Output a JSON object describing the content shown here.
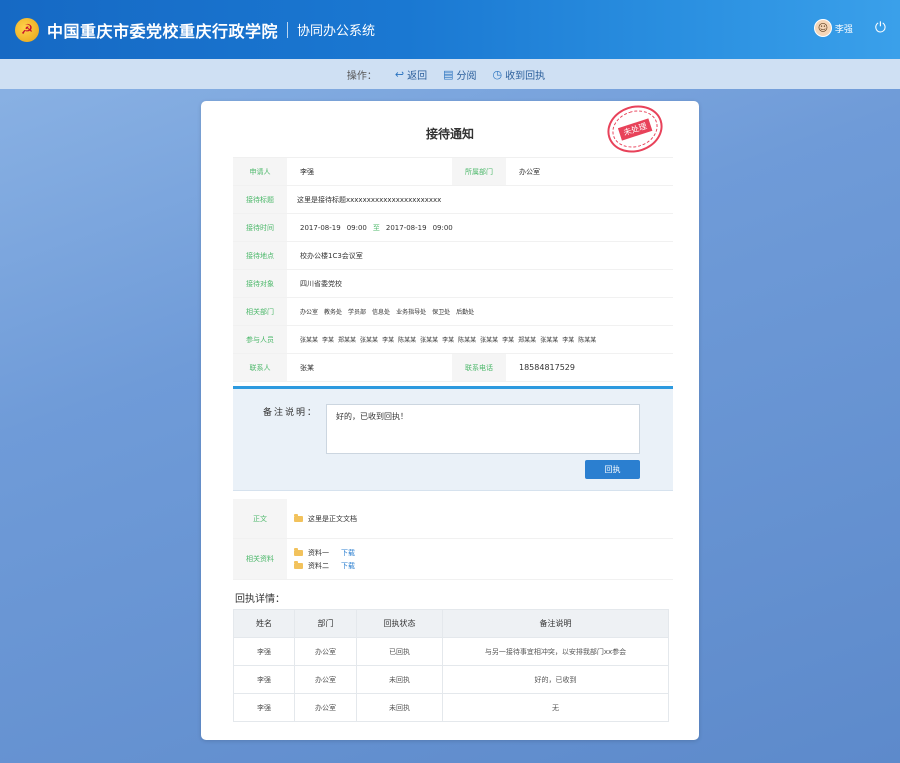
{
  "header": {
    "title": "中国重庆市委党校重庆行政学院",
    "subtitle": "协同办公系统",
    "username": "李强"
  },
  "toolbar": {
    "label": "操作：",
    "buttons": [
      "返回",
      "分阅",
      "收到回执"
    ]
  },
  "card": {
    "title": "接待通知",
    "stamp": "未处理",
    "fields": {
      "applicant_label": "申请人",
      "applicant": "李强",
      "dept_label": "所属部门",
      "dept": "办公室",
      "subject_label": "接待标题",
      "subject": "这里是接待标题xxxxxxxxxxxxxxxxxxxxxxx",
      "time_label": "接待时间",
      "time_start_date": "2017-08-19",
      "time_start": "09:00",
      "time_to": "至",
      "time_end_date": "2017-08-19",
      "time_end": "09:00",
      "place_label": "接待地点",
      "place": "校办公楼1C3会议室",
      "target_label": "接待对象",
      "target": "四川省委党校",
      "depts_label": "相关部门",
      "depts": [
        "办公室",
        "教务处",
        "学员部",
        "信息处",
        "业务指导处",
        "保卫处",
        "后勤处"
      ],
      "people_label": "参与人员",
      "people": [
        "张某某",
        "李某",
        "郑某某",
        "张某某",
        "李某",
        "陈某某",
        "张某某",
        "李某",
        "陈某某",
        "张某某",
        "李某",
        "郑某某",
        "张某某",
        "李某",
        "陈某某"
      ],
      "contact_label": "联系人",
      "contact": "张某",
      "phone_label": "联系电话",
      "phone": "18584817529"
    },
    "reply": {
      "label": "备注说明：",
      "text": "好的，已收到回执！",
      "button": "回执"
    },
    "attachments": {
      "body_label": "正文",
      "body_file": "这里是正文文档",
      "related_label": "相关资料",
      "files": [
        {
          "name": "资料一",
          "action": "下载"
        },
        {
          "name": "资料二",
          "action": "下载"
        }
      ]
    },
    "detail": {
      "title": "回执详情：",
      "columns": [
        "姓名",
        "部门",
        "回执状态",
        "备注说明"
      ],
      "rows": [
        {
          "name": "李强",
          "dept": "办公室",
          "status": "已回执",
          "note": "与另一接待事宜相冲突，以安排我部门xx参会"
        },
        {
          "name": "李强",
          "dept": "办公室",
          "status": "未回执",
          "note": "好的，已收到"
        },
        {
          "name": "李强",
          "dept": "办公室",
          "status": "未回执",
          "note": "无"
        }
      ]
    }
  },
  "colors": {
    "header": "#1a78d2",
    "label_green": "#4cb86a",
    "accent_blue": "#2b7fd0",
    "stamp_red": "#e8425a"
  },
  "icons": [
    "party-emblem-icon",
    "avatar-icon",
    "power-icon",
    "return-icon",
    "distribute-icon",
    "receipt-icon",
    "folder-icon"
  ]
}
